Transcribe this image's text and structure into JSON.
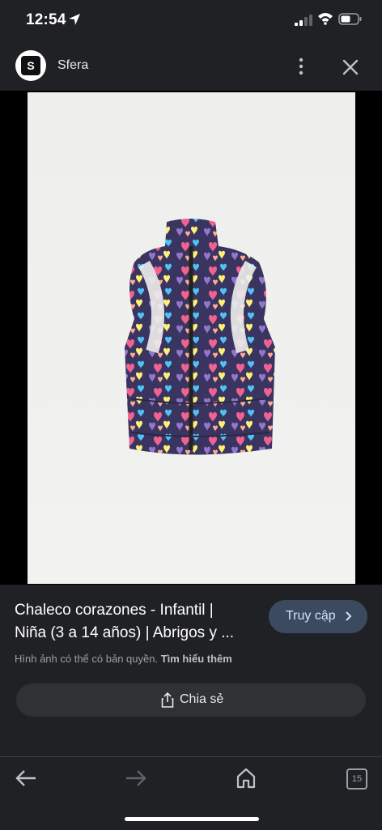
{
  "status_bar": {
    "time": "12:54"
  },
  "header": {
    "site_name": "Sfera",
    "logo_letter": "S"
  },
  "result": {
    "title_line1": "Chaleco corazones - Infantil |",
    "title_line2": "Niña (3 a 14 años) | Abrigos y ...",
    "visit_label": "Truy cập",
    "copyright_text": "Hình ảnh có thể có bản quyền.",
    "learn_more": "Tìm hiểu thêm",
    "share_label": "Chia sẻ"
  },
  "bottom_nav": {
    "tab_count": "15"
  },
  "colors": {
    "bar_bg": "#202124",
    "visit_bg": "#3c4a60",
    "share_bg": "#303134"
  },
  "icons": [
    "location-arrow-icon",
    "signal-icon",
    "wifi-icon",
    "battery-icon",
    "kebab-menu-icon",
    "close-icon",
    "chevron-right-icon",
    "share-icon",
    "back-arrow-icon",
    "forward-arrow-icon",
    "home-icon",
    "tabs-icon"
  ]
}
